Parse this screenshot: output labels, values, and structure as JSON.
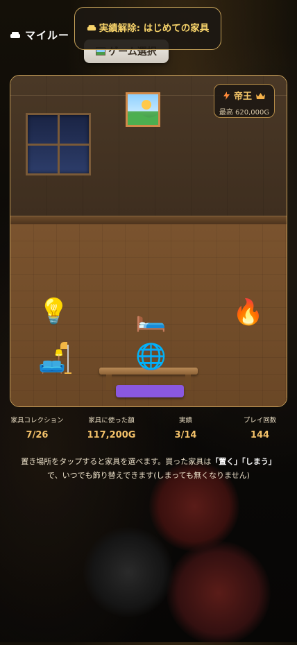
{
  "header": {
    "title": "マイルー",
    "game_select_label": "ゲーム選択",
    "toast_text": "実績解除: はじめての家具"
  },
  "room": {
    "rank_badge": {
      "title": "帝王",
      "best_label": "最高 620,000G"
    },
    "items": [
      {
        "name": "light-bulb",
        "icon": "💡"
      },
      {
        "name": "bed",
        "icon": "🛏️"
      },
      {
        "name": "fire",
        "icon": "🔥"
      },
      {
        "name": "couch-and-lamp",
        "icon": "🛋️"
      },
      {
        "name": "globe",
        "icon": "🌐"
      }
    ]
  },
  "stats": [
    {
      "label": "家具コレクション",
      "value": "7/26"
    },
    {
      "label": "家具に使った額",
      "value": "117,200G"
    },
    {
      "label": "実績",
      "value": "3/14"
    },
    {
      "label": "プレイ回数",
      "value": "144"
    }
  ],
  "description": {
    "part1": "置き場所をタップすると家具を選べます。買った家具は",
    "place": "「置く」",
    "store": "「しまう」",
    "part2": "で、いつでも飾り替えできます(しまっても無くなりません)"
  },
  "colors": {
    "accent": "#f4c26a",
    "frame": "#c9a05a",
    "rug": "#8a58e0"
  }
}
